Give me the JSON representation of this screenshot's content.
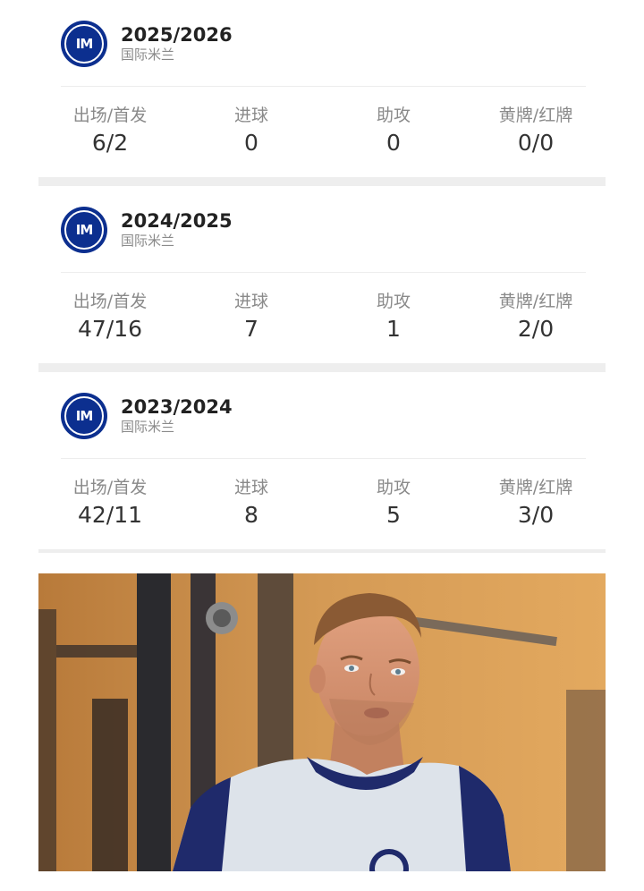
{
  "stat_labels": {
    "appearances": "出场/首发",
    "goals": "进球",
    "assists": "助攻",
    "cards": "黄牌/红牌"
  },
  "seasons": [
    {
      "year": "2025/2026",
      "club": "国际米兰",
      "appearances": "6/2",
      "goals": "0",
      "assists": "0",
      "cards": "0/0"
    },
    {
      "year": "2024/2025",
      "club": "国际米兰",
      "appearances": "47/16",
      "goals": "7",
      "assists": "1",
      "cards": "2/0"
    },
    {
      "year": "2023/2024",
      "club": "国际米兰",
      "appearances": "42/11",
      "goals": "8",
      "assists": "5",
      "cards": "3/0"
    }
  ],
  "club_logo_text": "IM",
  "colors": {
    "club_blue": "#0c2f8f",
    "divider": "#eeeeee",
    "muted_text": "#8a8a8a"
  }
}
